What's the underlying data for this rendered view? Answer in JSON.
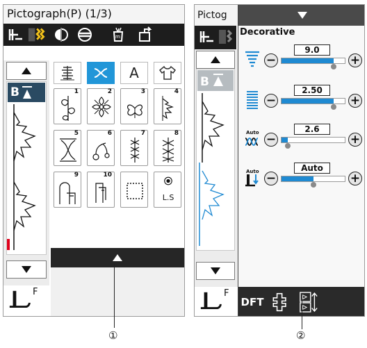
{
  "left_screen": {
    "title": "Pictograph(P) (1/3)",
    "bl_badge": "B",
    "tabs": [
      {
        "name": "tab-satin",
        "active": false
      },
      {
        "name": "tab-decorative",
        "active": true
      },
      {
        "name": "tab-letters",
        "label": "A",
        "active": false
      },
      {
        "name": "tab-applique",
        "active": false
      }
    ],
    "stitches": [
      {
        "num": "1"
      },
      {
        "num": "2"
      },
      {
        "num": "3"
      },
      {
        "num": "4"
      },
      {
        "num": "5"
      },
      {
        "num": "6"
      },
      {
        "num": "7"
      },
      {
        "num": "8"
      },
      {
        "num": "9"
      },
      {
        "num": "10"
      },
      {
        "num": ""
      },
      {
        "num": ""
      }
    ],
    "ls_label": "L.S",
    "foot_label": "F"
  },
  "right_screen": {
    "title": "Pictog",
    "section_label": "Decorative",
    "rows": [
      {
        "icon": "stitch-width-icon",
        "value": "9.0",
        "level": 0.82
      },
      {
        "icon": "stitch-length-icon",
        "value": "2.50",
        "level": 0.82
      },
      {
        "icon": "auto-tension-icon",
        "value": "2.6",
        "level": 0.1
      },
      {
        "icon": "auto-foot-pressure-icon",
        "value": "Auto",
        "level": 0.5
      }
    ],
    "minus_symbol": "−",
    "plus_symbol": "+",
    "auto_label": "Auto",
    "dft_label": "DFT",
    "foot_label": "F"
  },
  "callouts": {
    "one": "①",
    "two": "②"
  },
  "colors": {
    "accent": "#2196d8",
    "toolbar": "#1d1d1d",
    "red_mark": "#e0001b",
    "badge": "#2a4a62"
  }
}
